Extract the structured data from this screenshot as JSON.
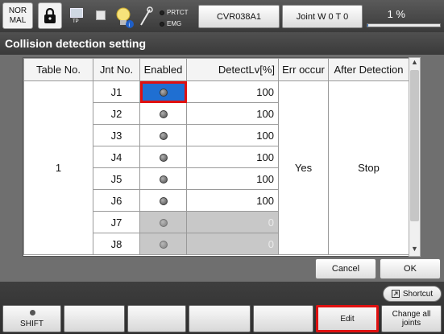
{
  "topbar": {
    "mode_label": "NOR\nMAL",
    "tp_label": "TP",
    "prtct_label": "PRTCT",
    "emg_label": "EMG",
    "program_label": "CVR038A1",
    "joint_label": "Joint  W 0 T 0",
    "speed_label": "1 %",
    "speed_percent": 1
  },
  "title": "Collision detection setting",
  "table": {
    "headers": [
      "Table No.",
      "Jnt No.",
      "Enabled",
      "DetectLv[%]",
      "Err occur",
      "After Detection"
    ],
    "table_no": "1",
    "err_occur": "Yes",
    "after_detection": "Stop",
    "rows": [
      {
        "jnt": "J1",
        "level": "100",
        "disabled": false
      },
      {
        "jnt": "J2",
        "level": "100",
        "disabled": false
      },
      {
        "jnt": "J3",
        "level": "100",
        "disabled": false
      },
      {
        "jnt": "J4",
        "level": "100",
        "disabled": false
      },
      {
        "jnt": "J5",
        "level": "100",
        "disabled": false
      },
      {
        "jnt": "J6",
        "level": "100",
        "disabled": false
      },
      {
        "jnt": "J7",
        "level": "0",
        "disabled": true
      },
      {
        "jnt": "J8",
        "level": "0",
        "disabled": true
      }
    ]
  },
  "buttons": {
    "cancel": "Cancel",
    "ok": "OK",
    "shortcut": "Shortcut"
  },
  "fkeys": {
    "f1": "SHIFT",
    "f2": "",
    "f3": "",
    "f4": "",
    "f5": "",
    "f6": "Edit",
    "f7": "Change all\njoints"
  },
  "colors": {
    "selected_cell": "#1f6fd2",
    "highlight": "#e01010",
    "speed_bar": "#2a73d0"
  }
}
